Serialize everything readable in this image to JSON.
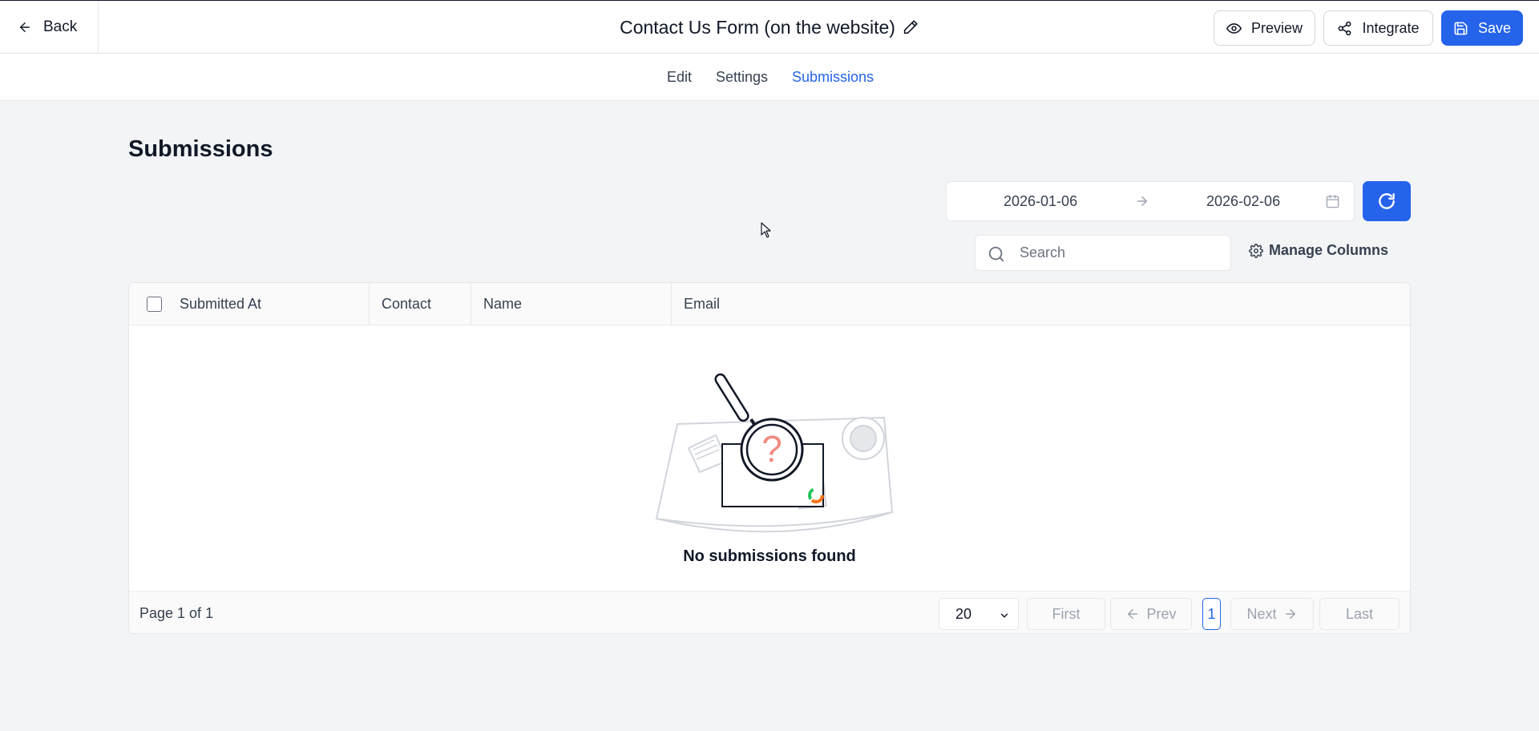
{
  "header": {
    "back_label": "Back",
    "form_title": "Contact Us Form (on the website)",
    "preview_label": "Preview",
    "integrate_label": "Integrate",
    "save_label": "Save"
  },
  "tabs": [
    {
      "label": "Edit",
      "active": false
    },
    {
      "label": "Settings",
      "active": false
    },
    {
      "label": "Submissions",
      "active": true
    }
  ],
  "page": {
    "title": "Submissions"
  },
  "filters": {
    "date_start": "2026-01-06",
    "date_end": "2026-02-06",
    "search_placeholder": "Search",
    "search_value": "",
    "manage_columns_label": "Manage Columns"
  },
  "table": {
    "columns": [
      "Submitted At",
      "Contact",
      "Name",
      "Email"
    ],
    "rows": [],
    "empty_message": "No submissions found"
  },
  "pagination": {
    "page_info": "Page 1 of 1",
    "page_size": "20",
    "first_label": "First",
    "prev_label": "Prev",
    "current_page": "1",
    "next_label": "Next",
    "last_label": "Last"
  },
  "colors": {
    "accent": "#2563eb",
    "background": "#f3f4f6",
    "border": "#e5e7eb"
  },
  "icons": [
    "arrow-left-icon",
    "pencil-icon",
    "eye-icon",
    "share-icon",
    "save-disk-icon",
    "arrow-right-icon",
    "calendar-icon",
    "refresh-icon",
    "search-icon",
    "gear-icon",
    "chevron-down-icon",
    "empty-search-illustration"
  ]
}
